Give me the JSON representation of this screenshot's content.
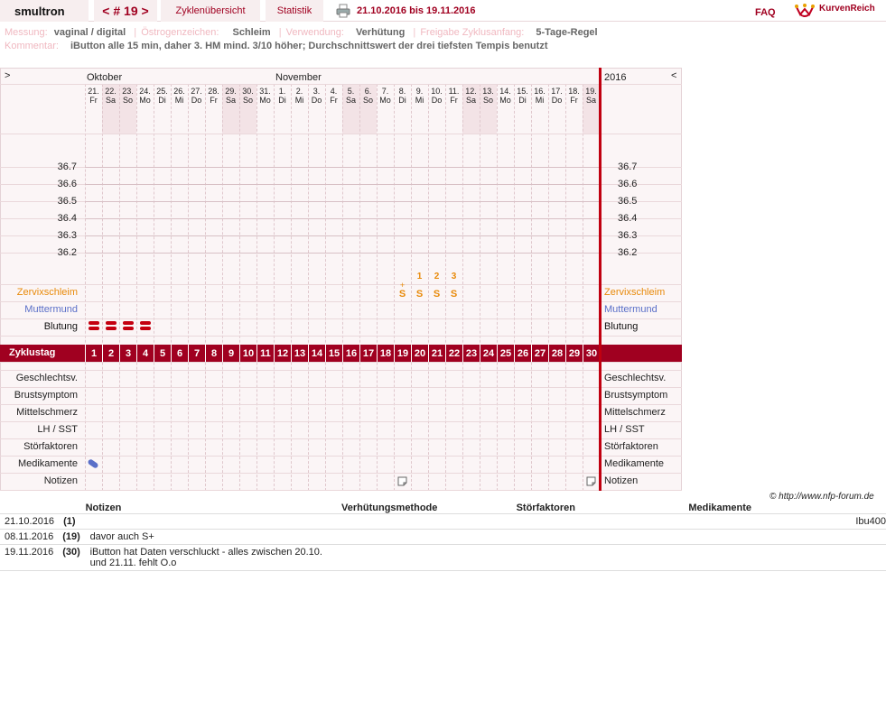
{
  "header": {
    "username": "smultron",
    "cycle_nav": "< # 19 >",
    "tabs": [
      "Zyklenübersicht",
      "Statistik"
    ],
    "date_range": "21.10.2016 bis 19.11.2016",
    "faq": "FAQ",
    "logo_text": "KurvenReich"
  },
  "meta": {
    "messung_label": "Messung:",
    "messung_value": "vaginal / digital",
    "oestrogen_label": "Östrogenzeichen:",
    "oestrogen_value": "Schleim",
    "verwendung_label": "Verwendung:",
    "verwendung_value": "Verhütung",
    "freigabe_label": "Freigabe Zyklusanfang:",
    "freigabe_value": "5-Tage-Regel",
    "kommentar_label": "Kommentar:",
    "kommentar_value": "iButton alle 15 min, daher 3. HM mind. 3/10 höher; Durchschnittswert der drei tiefsten Tempis benutzt"
  },
  "chart": {
    "nav_left": ">",
    "nav_right": "<",
    "year": "2016",
    "months": [
      "Oktober",
      "November"
    ],
    "dates": [
      "21.",
      "22.",
      "23.",
      "24.",
      "25.",
      "26.",
      "27.",
      "28.",
      "29.",
      "30.",
      "31.",
      "1.",
      "2.",
      "3.",
      "4.",
      "5.",
      "6.",
      "7.",
      "8.",
      "9.",
      "10.",
      "11.",
      "12.",
      "13.",
      "14.",
      "15.",
      "16.",
      "17.",
      "18.",
      "19."
    ],
    "weekdays": [
      "Fr",
      "Sa",
      "So",
      "Mo",
      "Di",
      "Mi",
      "Do",
      "Fr",
      "Sa",
      "So",
      "Mo",
      "Di",
      "Mi",
      "Do",
      "Fr",
      "Sa",
      "So",
      "Mo",
      "Di",
      "Mi",
      "Do",
      "Fr",
      "Sa",
      "So",
      "Mo",
      "Di",
      "Mi",
      "Do",
      "Fr",
      "Sa"
    ],
    "weekend_days": [
      2,
      3,
      9,
      10,
      16,
      17,
      23,
      24,
      30
    ],
    "temp_ticks": [
      "36.7",
      "36.6",
      "36.5",
      "36.4",
      "36.3",
      "36.2"
    ],
    "cycle_label": "Zyklustag",
    "cycle_days": [
      "1",
      "2",
      "3",
      "4",
      "5",
      "6",
      "7",
      "8",
      "9",
      "10",
      "11",
      "12",
      "13",
      "14",
      "15",
      "16",
      "17",
      "18",
      "19",
      "20",
      "21",
      "22",
      "23",
      "24",
      "25",
      "26",
      "27",
      "28",
      "29",
      "30"
    ],
    "rows_upper": [
      "Zervixschleim",
      "Muttermund",
      "Blutung"
    ],
    "rows_lower": [
      "Geschlechtsv.",
      "Brustsymptom",
      "Mittelschmerz",
      "LH / SST",
      "Störfaktoren",
      "Medikamente",
      "Notizen"
    ],
    "mucus": [
      {
        "day": 19,
        "value": "S",
        "plus": "+"
      },
      {
        "day": 20,
        "value": "S",
        "count": "1"
      },
      {
        "day": 21,
        "value": "S",
        "count": "2"
      },
      {
        "day": 22,
        "value": "S",
        "count": "3"
      }
    ],
    "bleeding_days": [
      1,
      2,
      3,
      4
    ],
    "medication_days": [
      1
    ],
    "note_days": [
      19,
      30
    ],
    "colors": {
      "accent": "#a00020",
      "mucus": "#e88a0a",
      "cervix": "#5a6fc8",
      "bleeding": "#c40010",
      "weekend": "#f3e3e6"
    }
  },
  "copyright": "© http://www.nfp-forum.de",
  "notes_table": {
    "headers": [
      "Notizen",
      "Verhütungsmethode",
      "Störfaktoren",
      "Medikamente"
    ],
    "rows": [
      {
        "date": "21.10.2016",
        "day": "(1)",
        "note": "",
        "method": "",
        "disturbance": "",
        "medication": "Ibu400"
      },
      {
        "date": "08.11.2016",
        "day": "(19)",
        "note": "davor auch S+",
        "method": "",
        "disturbance": "",
        "medication": ""
      },
      {
        "date": "19.11.2016",
        "day": "(30)",
        "note": "iButton hat Daten verschluckt - alles zwischen 20.10. und 21.11. fehlt O.o",
        "method": "",
        "disturbance": "",
        "medication": ""
      }
    ]
  }
}
